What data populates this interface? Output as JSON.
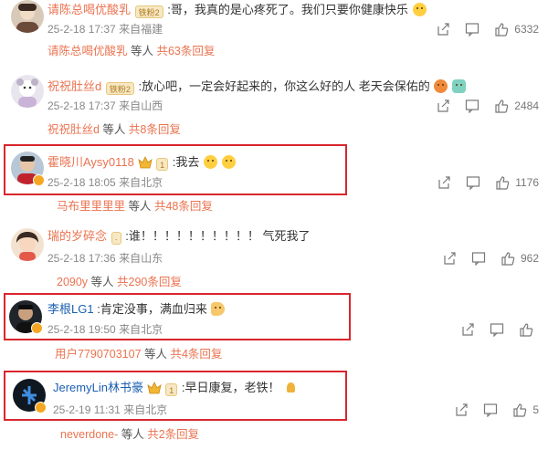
{
  "comments": [
    {
      "username": "请陈总喝优酸乳",
      "badge": "铁粉2",
      "text": ":哥，我真的是心疼死了。我们只要你健康快乐",
      "date": "25-2-18 17:37",
      "location": "来自福建",
      "likes": "6332",
      "reply_user": "请陈总喝优酸乳",
      "reply_mid": " 等人 ",
      "reply_more": "共63条回复"
    },
    {
      "username": "祝祝肚丝d",
      "badge": "铁粉2",
      "text": ":放心吧，一定会好起来的，你这么好的人 老天会保佑的",
      "date": "25-2-18 17:37",
      "location": "来自山西",
      "likes": "2484",
      "reply_user": "祝祝肚丝d",
      "reply_mid": " 等人 ",
      "reply_more": "共8条回复"
    },
    {
      "username": "霍晓川Aysy0118",
      "badge": "1",
      "text": ":我去",
      "date": "25-2-18 18:05",
      "location": "来自北京",
      "likes": "1176",
      "reply_user": "马布里里里里",
      "reply_mid": " 等人 ",
      "reply_more": "共48条回复"
    },
    {
      "username": "瑞的岁碎念",
      "badge": "",
      "text": ":谁！！！！！！！！！！ 气死我了",
      "date": "25-2-18 17:36",
      "location": "来自山东",
      "likes": "962",
      "reply_user": "2090y",
      "reply_mid": " 等人 ",
      "reply_more": "共290条回复"
    },
    {
      "username": "李根LG1",
      "badge": "",
      "text": ":肯定没事，满血归来",
      "date": "25-2-18 19:50",
      "location": "来自北京",
      "likes": "",
      "reply_user": "用户7790703107",
      "reply_mid": " 等人 ",
      "reply_more": "共4条回复"
    },
    {
      "username": "JeremyLin林书豪",
      "badge": "1",
      "text": ":早日康复，老铁！",
      "date": "25-2-19 11:31",
      "location": "来自北京",
      "likes": "5",
      "reply_user": "neverdone-",
      "reply_mid": " 等人 ",
      "reply_more": "共2条回复"
    }
  ],
  "colors": {
    "username": "#eb7350",
    "highlight_box": "#d9262d",
    "meta": "#888888"
  },
  "icons": [
    "share-icon",
    "comment-icon",
    "like-icon",
    "crown-icon"
  ]
}
